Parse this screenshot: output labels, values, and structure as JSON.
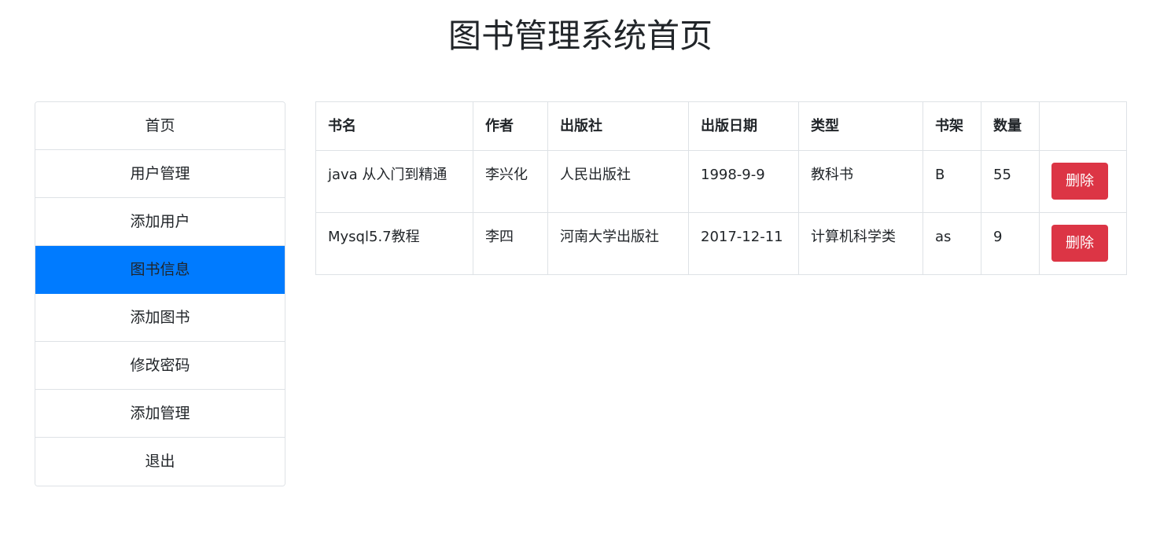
{
  "header": {
    "title": "图书管理系统首页"
  },
  "sidebar": {
    "items": [
      {
        "label": "首页"
      },
      {
        "label": "用户管理"
      },
      {
        "label": "添加用户"
      },
      {
        "label": "图书信息"
      },
      {
        "label": "添加图书"
      },
      {
        "label": "修改密码"
      },
      {
        "label": "添加管理"
      },
      {
        "label": "退出"
      }
    ],
    "active_index": 3,
    "active_color": "#007bff"
  },
  "table": {
    "headers": [
      "书名",
      "作者",
      "出版社",
      "出版日期",
      "类型",
      "书架",
      "数量",
      ""
    ],
    "rows": [
      {
        "name": "java 从入门到精通",
        "author": "李兴化",
        "publisher": "人民出版社",
        "date": "1998-9-9",
        "type": "教科书",
        "shelf": "B",
        "quantity": "55",
        "action": "删除"
      },
      {
        "name": "Mysql5.7教程",
        "author": "李四",
        "publisher": "河南大学出版社",
        "date": "2017-12-11",
        "type": "计算机科学类",
        "shelf": "as",
        "quantity": "9",
        "action": "删除"
      }
    ],
    "delete_color": "#dc3545"
  }
}
